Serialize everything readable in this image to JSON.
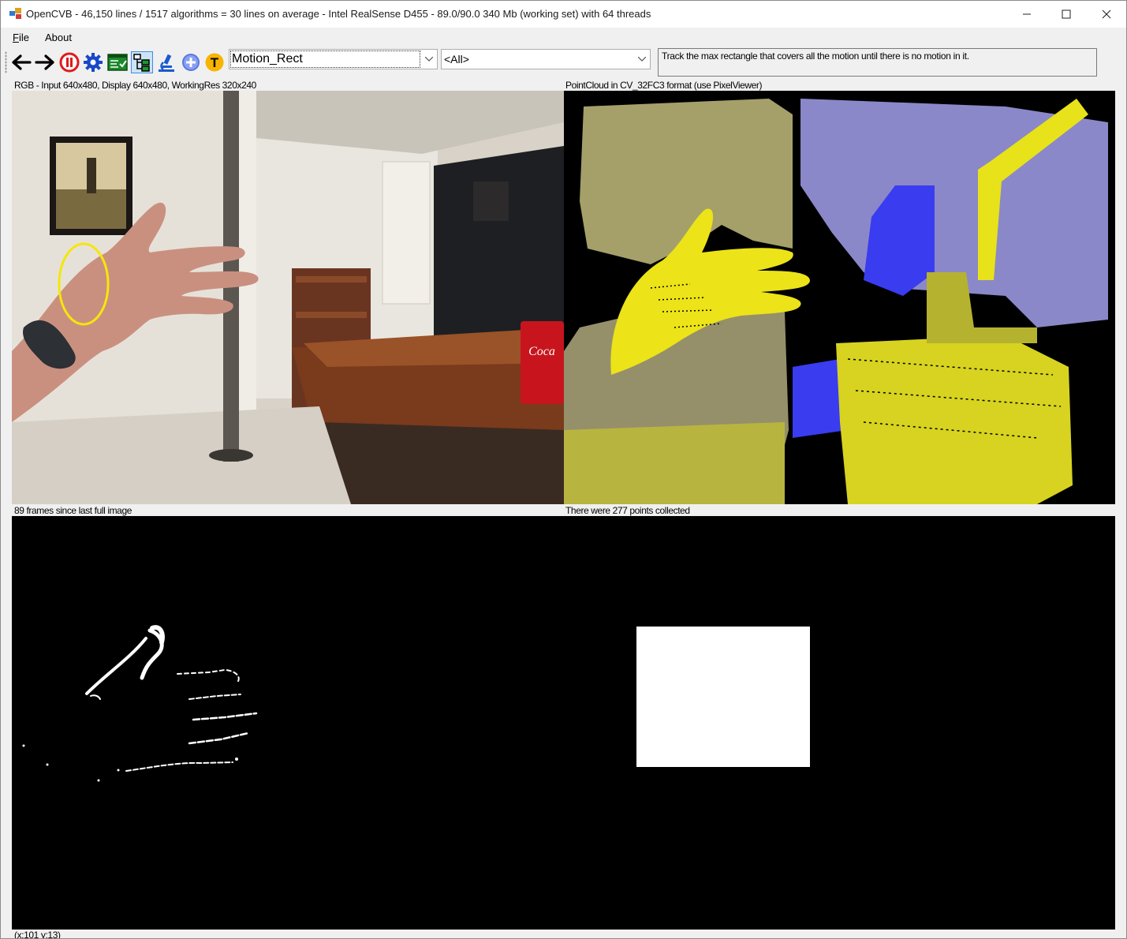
{
  "window": {
    "title": "OpenCVB - 46,150 lines / 1517 algorithms = 30 lines on average - Intel RealSense D455 - 89.0/90.0 340 Mb (working set) with 64 threads",
    "minimize_label": "—",
    "maximize_label": "☐",
    "close_label": "✕"
  },
  "menu": {
    "items": [
      {
        "label": "File"
      },
      {
        "label": "About"
      }
    ]
  },
  "toolbar": {
    "icons": [
      "back-arrow-icon",
      "forward-arrow-icon",
      "pause-icon",
      "settings-gear-icon",
      "test-all-icon",
      "tree-view-icon",
      "microscope-icon",
      "add-icon",
      "translate-icon"
    ],
    "algorithm_select": "Motion_Rect",
    "group_select": "<All>",
    "description": "Track the max rectangle that covers all the motion until there is no motion in it."
  },
  "panes": {
    "top_left_caption": "RGB - Input 640x480, Display 640x480, WorkingRes 320x240",
    "top_right_caption": "PointCloud in CV_32FC3 format (use PixelViewer)",
    "bottom_left_caption": "89 frames since last full image",
    "bottom_right_caption": "There were 277 points collected"
  },
  "status": {
    "coords": "(x:101 y:13)"
  },
  "colors": {
    "accent": "#0078d4",
    "highlight_circle": "#f5e60a",
    "pointcloud_yellow": "#e8e21a",
    "pointcloud_blue": "#3a3cf0"
  }
}
